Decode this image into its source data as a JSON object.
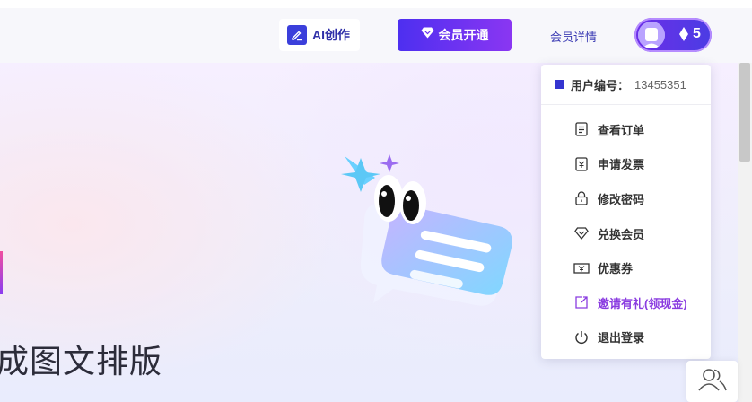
{
  "header": {
    "ai_button_label": "AI创作",
    "vip_button_label": "会员开通",
    "member_details_label": "会员详情",
    "coin_count": "5"
  },
  "hero": {
    "headline_fragment": "成图文排版"
  },
  "dropdown": {
    "user_id_label": "用户编号：",
    "user_id_value": "13455351",
    "items": [
      {
        "label": "查看订单",
        "icon": "order-list-icon"
      },
      {
        "label": "申请发票",
        "icon": "invoice-icon"
      },
      {
        "label": "修改密码",
        "icon": "lock-icon"
      },
      {
        "label": "兑换会员",
        "icon": "diamond-icon"
      },
      {
        "label": "优惠券",
        "icon": "coupon-icon"
      },
      {
        "label": "邀请有礼(领现金)",
        "icon": "share-icon"
      },
      {
        "label": "退出登录",
        "icon": "power-icon"
      }
    ]
  },
  "colors": {
    "accent": "#3b3fdb",
    "vip_gradient_start": "#4d2ff0",
    "vip_gradient_end": "#8a36f2",
    "invite_text": "#8a3ce0"
  }
}
